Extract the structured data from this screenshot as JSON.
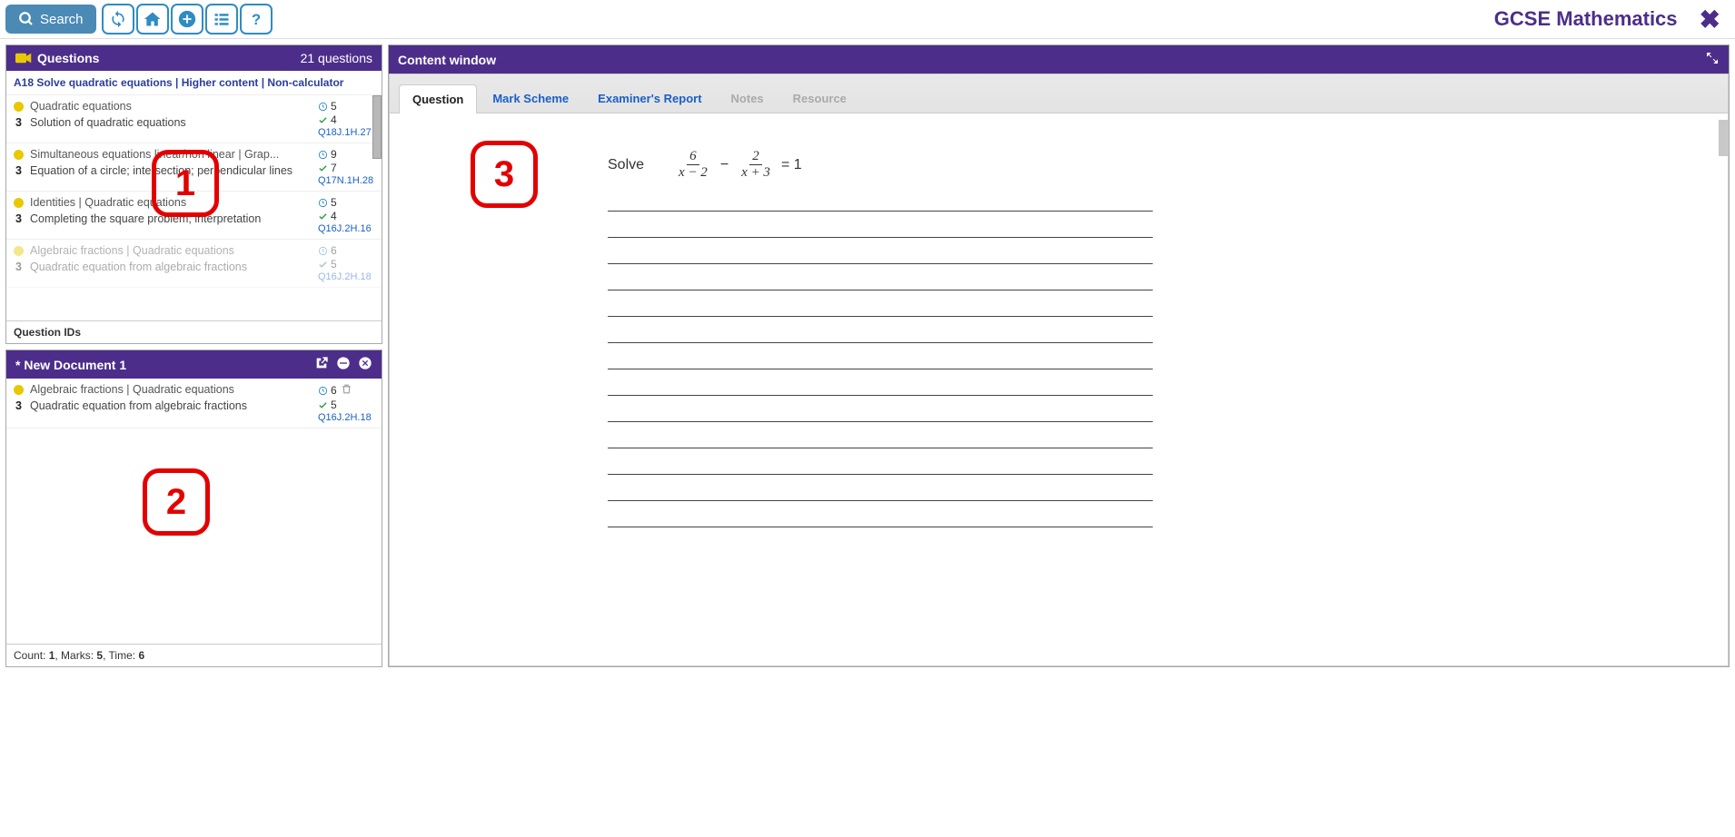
{
  "topbar": {
    "search_label": "Search",
    "page_title": "GCSE Mathematics"
  },
  "questions_panel": {
    "header_icon": "camera-icon",
    "title": "Questions",
    "count_text": "21 questions",
    "breadcrumb": "A18 Solve quadratic equations  | Higher content  | Non-calculator",
    "items": [
      {
        "dot": true,
        "title": "Quadratic equations",
        "num": "3",
        "sub": "Solution of quadratic equations",
        "clock": "5",
        "check": "4",
        "qid": "Q18J.1H.27",
        "faded": false
      },
      {
        "dot": true,
        "title": "Simultaneous equations linear/non linear | Grap...",
        "num": "3",
        "sub": "Equation of a circle; intersection; perpendicular lines",
        "clock": "9",
        "check": "7",
        "qid": "Q17N.1H.28",
        "faded": false
      },
      {
        "dot": true,
        "title": "Identities | Quadratic equations",
        "num": "3",
        "sub": "Completing the square problem; interpretation",
        "clock": "5",
        "check": "4",
        "qid": "Q16J.2H.16",
        "faded": false
      },
      {
        "dot": true,
        "title": "Algebraic fractions | Quadratic equations",
        "num": "3",
        "sub": "Quadratic equation from algebraic fractions",
        "clock": "6",
        "check": "5",
        "qid": "Q16J.2H.18",
        "faded": true
      }
    ],
    "footer_label": "Question IDs"
  },
  "doc_panel": {
    "title": "* New Document 1",
    "items": [
      {
        "dot": true,
        "title": "Algebraic fractions | Quadratic equations",
        "num": "3",
        "sub": "Quadratic equation from algebraic fractions",
        "clock": "6",
        "check": "5",
        "qid": "Q16J.2H.18"
      }
    ],
    "footer": {
      "count_label": "Count: ",
      "count": "1",
      "marks_label": ", Marks: ",
      "marks": "5",
      "time_label": ", Time: ",
      "time": "6"
    }
  },
  "content_panel": {
    "title": "Content window",
    "tabs": [
      {
        "label": "Question",
        "state": "active"
      },
      {
        "label": "Mark Scheme",
        "state": "link"
      },
      {
        "label": "Examiner's Report",
        "state": "link"
      },
      {
        "label": "Notes",
        "state": "disabled"
      },
      {
        "label": "Resource",
        "state": "disabled"
      }
    ],
    "question": {
      "prompt": "Solve",
      "frac1_num": "6",
      "frac1_den": "x − 2",
      "minus": "−",
      "frac2_num": "2",
      "frac2_den": "x + 3",
      "equals": "= 1",
      "line_count": 13
    }
  },
  "annotations": {
    "a1": "1",
    "a2": "2",
    "a3": "3"
  }
}
